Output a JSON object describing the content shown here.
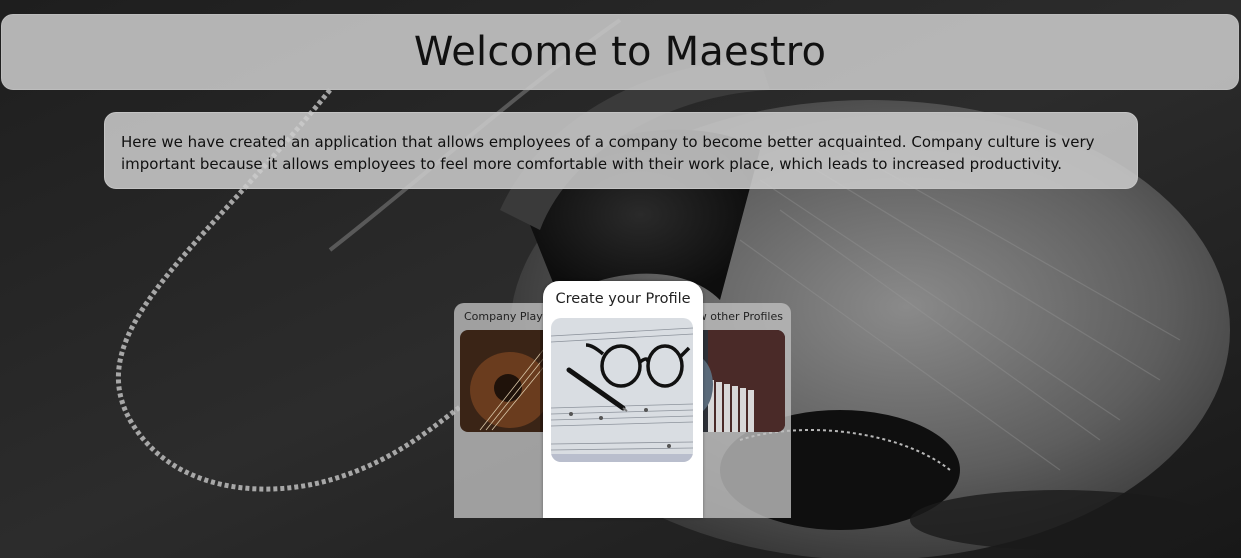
{
  "header": {
    "title": "Welcome to Maestro"
  },
  "intro": {
    "text": "Here we have created an application that allows employees of a company to become better acquainted. Company culture is very important because it allows employees to feel more comfortable with their work place, which leads to increased productivity."
  },
  "cards": {
    "left": {
      "title": "Company Playlist"
    },
    "center": {
      "title": "Create your Profile"
    },
    "right": {
      "title": "View other Profiles"
    }
  },
  "colors": {
    "panel": "#cdcdcd",
    "center_card": "#ffffff",
    "text": "#111111"
  }
}
